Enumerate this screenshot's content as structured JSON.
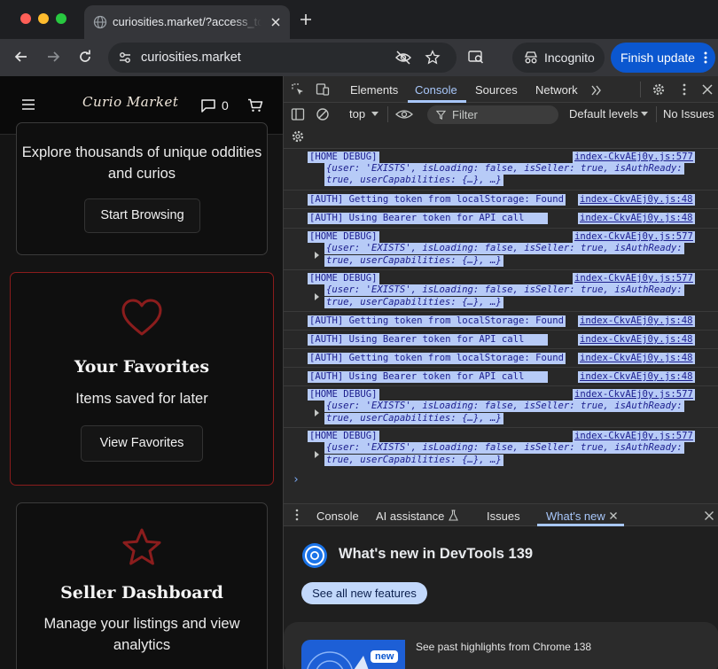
{
  "browser": {
    "tab_title": "curiosities.market/?access_to",
    "url": "curiosities.market",
    "incognito_label": "Incognito",
    "update_label": "Finish update"
  },
  "site": {
    "logo": "Curio Market",
    "message_count": "0",
    "cards": [
      {
        "text": "Explore thousands of unique oddities and curios",
        "button": "Start Browsing"
      },
      {
        "icon": "heart-icon",
        "title": "Your Favorites",
        "text": "Items saved for later",
        "button": "View Favorites"
      },
      {
        "icon": "star-icon",
        "title": "Seller Dashboard",
        "text": "Manage your listings and view analytics"
      }
    ]
  },
  "devtools": {
    "tabs": [
      "Elements",
      "Console",
      "Sources",
      "Network"
    ],
    "active_tab": "Console",
    "context": "top",
    "filter_placeholder": "Filter",
    "levels": "Default levels",
    "issues": "No Issues",
    "log": {
      "home_debug": "[HOME DEBUG]",
      "home_src": "index-CkvAEj0y.js:577",
      "obj_line1": "{user: 'EXISTS', isLoading: false, isSeller: true, isAuthReady:",
      "obj_line2": "true, userCapabilities: {…}, …}",
      "auth_token": "[AUTH] Getting token from localStorage: Found",
      "auth_bearer": "[AUTH] Using Bearer token for API call",
      "auth_src": "index-CkvAEj0y.js:48"
    },
    "drawer_tabs": [
      "Console",
      "AI assistance",
      "Issues",
      "What's new"
    ],
    "active_drawer_tab": "What's new",
    "whatsnew_title": "What's new in DevTools 139",
    "whatsnew_button": "See all new features",
    "new_badge": "new",
    "past_highlights": "See past highlights from Chrome 138"
  },
  "colors": {
    "accent": "#a8c7fa",
    "favorites_border": "#8a1c1c",
    "icon_red": "#8b1d1d",
    "update_blue": "#0b57d0"
  }
}
